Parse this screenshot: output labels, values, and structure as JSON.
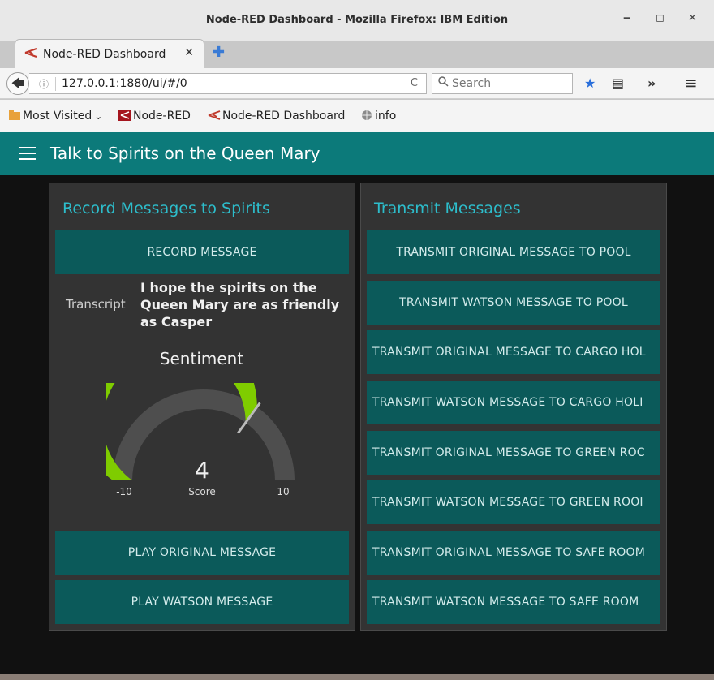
{
  "window": {
    "title": "Node-RED Dashboard - Mozilla Firefox: IBM Edition",
    "minimize_glyph": "‒",
    "maximize_glyph": "◻",
    "close_glyph": "✕"
  },
  "tab": {
    "label": "Node-RED Dashboard",
    "close_glyph": "✕",
    "new_tab_glyph": "✚",
    "icon": "node-red-dashboard-icon"
  },
  "nav": {
    "back_glyph": "🡄",
    "info_glyph": "ⓘ",
    "url": "127.0.0.1:1880/ui/#/0",
    "reload_glyph": "C",
    "search_placeholder": "Search",
    "search_glyph": "🔍",
    "bookmark_star_glyph": "★",
    "reader_glyph": "▤",
    "overflow_glyph": "»",
    "menu_glyph": "≡"
  },
  "bookmarks": [
    {
      "label": "Most Visited",
      "suffix": "⌄",
      "icon": "folder-icon"
    },
    {
      "label": "Node-RED",
      "icon": "node-red-icon"
    },
    {
      "label": "Node-RED Dashboard",
      "icon": "node-red-dashboard-icon"
    },
    {
      "label": "info",
      "icon": "globe-icon"
    }
  ],
  "dashboard": {
    "title": "Talk to Spirits on the Queen Mary",
    "colors": {
      "header": "#0c7a7a",
      "button": "#0b5a5a",
      "accent": "#2dbdcb",
      "gauge_fill": "#7fcc00",
      "gauge_track": "#4e4e4e",
      "card": "#333333",
      "background": "#111111"
    }
  },
  "record_group": {
    "title": "Record Messages to Spirits",
    "record_button": "RECORD MESSAGE",
    "transcript_label": "Transcript",
    "transcript_text": "I hope the spirits on the Queen Mary are as friendly as Casper",
    "gauge": {
      "title": "Sentiment",
      "value": 4,
      "min": -10,
      "max": 10,
      "units": "Score",
      "min_label": "-10",
      "max_label": "10",
      "value_label": "4"
    },
    "play_original_button": "PLAY ORIGINAL MESSAGE",
    "play_watson_button": "PLAY WATSON MESSAGE"
  },
  "transmit_group": {
    "title": "Transmit Messages",
    "buttons": [
      "TRANSMIT ORIGINAL MESSAGE TO POOL",
      "TRANSMIT WATSON MESSAGE TO POOL",
      "TRANSMIT ORIGINAL MESSAGE TO CARGO HOL",
      "TRANSMIT WATSON MESSAGE TO CARGO HOLI",
      "TRANSMIT ORIGINAL MESSAGE TO GREEN ROC",
      "TRANSMIT WATSON MESSAGE TO GREEN ROOI",
      "TRANSMIT ORIGINAL MESSAGE TO SAFE ROOM",
      "TRANSMIT WATSON MESSAGE TO SAFE ROOM"
    ]
  }
}
